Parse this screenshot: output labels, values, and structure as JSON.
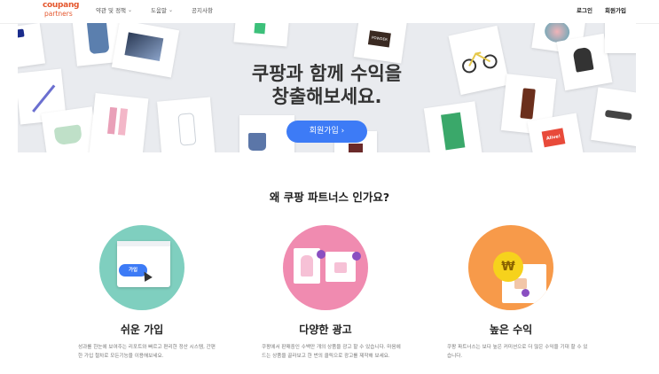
{
  "nav": {
    "logo_line1": "coupang",
    "logo_line2": "partners",
    "menu": [
      "약관 및 정책",
      "도움말",
      "공지사항"
    ],
    "login": "로그인",
    "signup": "회원가입"
  },
  "hero": {
    "title_line1": "쿠팡과 함께 수익을",
    "title_line2": "창출해보세요.",
    "button_label": "회원가입 ›",
    "powder_text": "POWDER",
    "aloe_text": "Alive!"
  },
  "why": {
    "title": "왜 쿠팡 파트너스 인가요?",
    "features": [
      {
        "title": "쉬운 가입",
        "desc": "성과를 한눈에 보여주는 리포트와 빠르고 편리한 정산 시스템, 간편한 가입 절차로 모든기능을 이용해보세요.",
        "button_text": "가입"
      },
      {
        "title": "다양한 광고",
        "desc": "쿠팡에서 판매중인 수백만 개의 상품을 광고 할 수 있습니다. 마음에 드는 상품을 골라보고 한 번의 클릭으로 광고를 제작해 보세요."
      },
      {
        "title": "높은 수익",
        "desc": "쿠팡 파트너스는 보다 높은 커미션으로 더 많은 수익을 기대 할 수 있습니다.",
        "coin": "₩"
      }
    ]
  },
  "colors": {
    "primary": "#3d7bf6",
    "teal": "#7fcfbf",
    "pink": "#f08bb0",
    "orange": "#f79a4a"
  }
}
